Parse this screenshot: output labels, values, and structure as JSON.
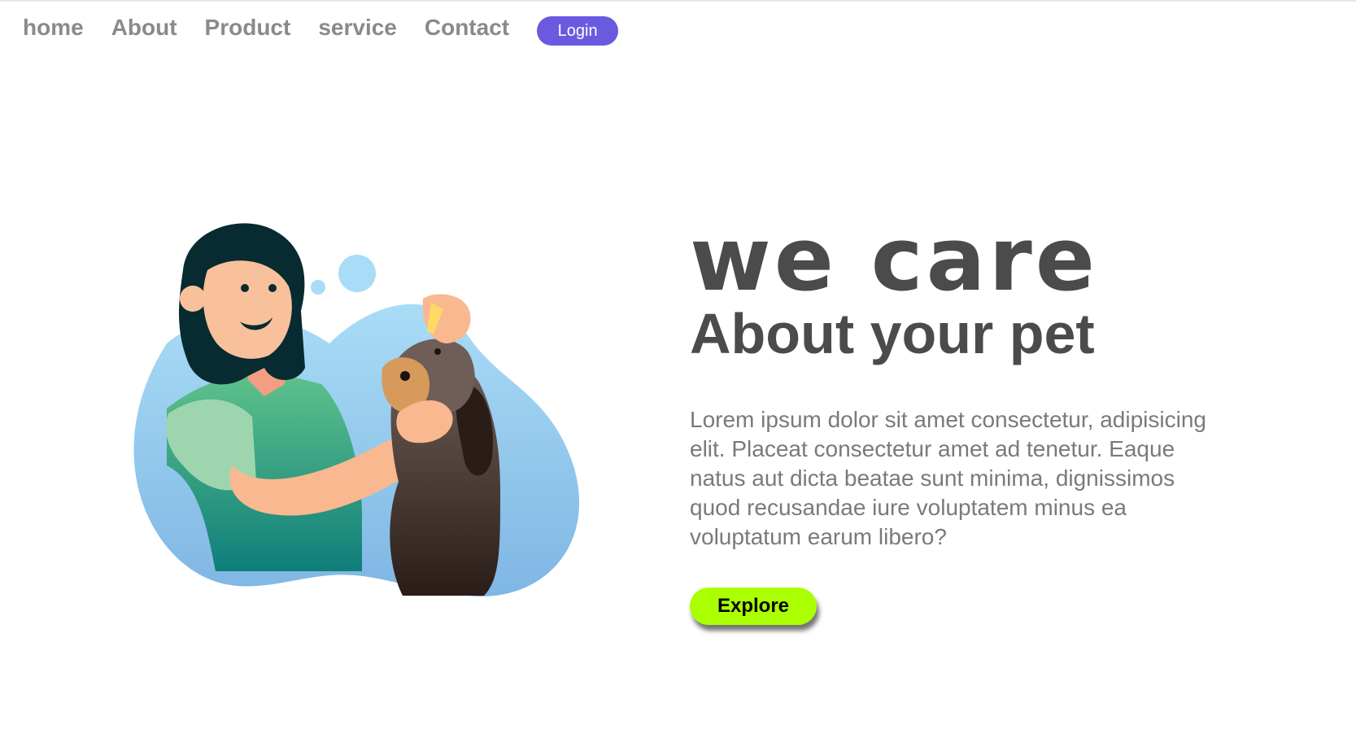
{
  "nav": {
    "items": [
      {
        "label": "home"
      },
      {
        "label": "About"
      },
      {
        "label": "Product"
      },
      {
        "label": "service"
      },
      {
        "label": "Contact"
      }
    ],
    "login_label": "Login"
  },
  "hero": {
    "headline": "we care",
    "subheadline": "About your pet",
    "description": "Lorem ipsum dolor sit amet consectetur, adipisicing elit. Placeat consectetur amet ad tenetur. Eaque natus aut dicta beatae sunt minima, dignissimos quod recusandae iure voluptatem minus ea voluptatum earum libero?",
    "explore_label": "Explore"
  },
  "colors": {
    "nav_text": "#8a8a8a",
    "login_bg": "#6a5ae0",
    "heading_text": "#4b4b4b",
    "body_text": "#7a7a7a",
    "explore_bg": "#aaff00",
    "blob_blue": "#9fd3f2"
  },
  "illustration": {
    "icon": "vet-with-dog-illustration"
  }
}
